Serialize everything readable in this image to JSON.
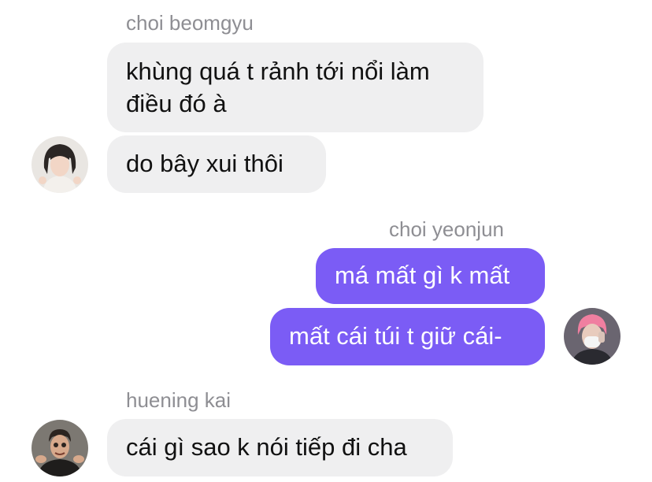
{
  "colors": {
    "incoming_bubble": "#efeff0",
    "outgoing_bubble": "#7b5cf5",
    "name_text": "#8e8e93"
  },
  "messages": [
    {
      "sender": "choi beomgyu",
      "direction": "incoming",
      "bubbles": [
        "khùng quá t rảnh tới nổi làm",
        "điều đó à",
        "do bây xui thôi"
      ]
    },
    {
      "sender": "choi yeonjun",
      "direction": "outgoing",
      "bubbles": [
        "má mất gì k mất",
        "mất cái túi t giữ cái-"
      ]
    },
    {
      "sender": "huening kai",
      "direction": "incoming",
      "bubbles": [
        "cái gì sao k nói tiếp đi cha"
      ]
    }
  ]
}
